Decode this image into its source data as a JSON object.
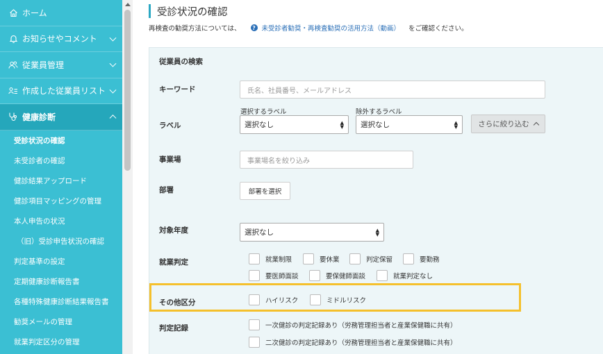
{
  "sidebar": {
    "main_items": [
      {
        "label": "ホーム",
        "icon": "home-icon"
      },
      {
        "label": "お知らせやコメント",
        "icon": "bell-icon"
      },
      {
        "label": "従業員管理",
        "icon": "users-icon"
      },
      {
        "label": "作成した従業員リスト",
        "icon": "user-list-icon"
      },
      {
        "label": "健康診断",
        "icon": "stethoscope-icon"
      }
    ],
    "sub_items": [
      "受診状況の確認",
      "未受診者の確認",
      "健診結果アップロード",
      "健診項目マッピングの管理",
      "本人申告の状況",
      "（旧）受診申告状況の確認",
      "判定基準の設定",
      "定期健康診断報告書",
      "各種特殊健康診断結果報告書",
      "勧奨メールの管理",
      "就業判定区分の管理"
    ]
  },
  "page": {
    "title": "受診状況の確認",
    "intro_before": "再検査の勧奨方法については、",
    "help_link": "未受診者勧奨・再検査勧奨の活用方法（動画）",
    "intro_after": "をご確認ください。"
  },
  "search": {
    "section_title": "従業員の検索",
    "keyword": {
      "label": "キーワード",
      "placeholder": "氏名、社員番号、メールアドレス"
    },
    "label_field": {
      "label": "ラベル",
      "include_label": "選択するラベル",
      "include_value": "選択なし",
      "exclude_label": "除外するラベル",
      "exclude_value": "選択なし",
      "refine_button": "さらに絞り込む"
    },
    "office": {
      "label": "事業場",
      "placeholder": "事業場名を絞り込み"
    },
    "department": {
      "label": "部署",
      "button": "部署を選択"
    },
    "year": {
      "label": "対象年度",
      "value": "選択なし"
    },
    "work_judgement": {
      "label": "就業判定",
      "options": [
        "就業制限",
        "要休業",
        "判定保留",
        "要勤務",
        "要医師面談",
        "要保健師面談",
        "就業判定なし"
      ]
    },
    "other": {
      "label": "その他区分",
      "options": [
        "ハイリスク",
        "ミドルリスク"
      ]
    },
    "record": {
      "label": "判定記録",
      "options": [
        "一次健診の判定記録あり（労務管理担当者と産業保健職に共有）",
        "二次健診の判定記録あり（労務管理担当者と産業保健職に共有）"
      ]
    }
  },
  "colors": {
    "sidebar": "#3bbfd3",
    "accent": "#2ba8c3",
    "highlight": "#f5c02c",
    "link": "#2a6fb7"
  }
}
